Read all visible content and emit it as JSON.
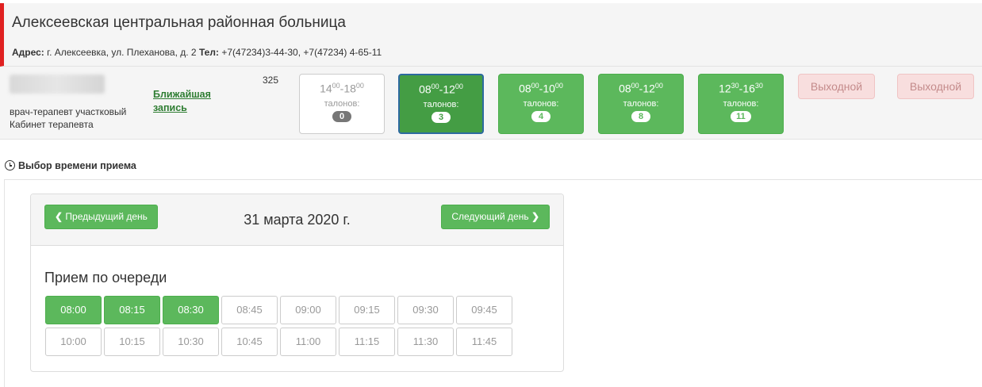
{
  "hospital": {
    "name": "Алексеевская центральная районная больница",
    "address_label": "Адрес:",
    "address": "г. Алексеевка, ул. Плеханова, д. 2",
    "phone_label": "Тел:",
    "phone": "+7(47234)3-44-30, +7(47234) 4-65-11"
  },
  "doctor": {
    "specialty": "врач-терапевт участковый",
    "cabinet": "Кабинет терапевта",
    "nearest_line1": "Ближайшая",
    "nearest_line2": "запись",
    "room": "325"
  },
  "schedule": [
    {
      "start_h": "14",
      "start_m": "00",
      "end_h": "18",
      "end_m": "00",
      "label": "талонов:",
      "count": "0",
      "state": "inactive"
    },
    {
      "start_h": "08",
      "start_m": "00",
      "end_h": "12",
      "end_m": "00",
      "label": "талонов:",
      "count": "3",
      "state": "active"
    },
    {
      "start_h": "08",
      "start_m": "00",
      "end_h": "10",
      "end_m": "00",
      "label": "талонов:",
      "count": "4",
      "state": "available"
    },
    {
      "start_h": "08",
      "start_m": "00",
      "end_h": "12",
      "end_m": "00",
      "label": "талонов:",
      "count": "8",
      "state": "available"
    },
    {
      "start_h": "12",
      "start_m": "30",
      "end_h": "16",
      "end_m": "30",
      "label": "талонов:",
      "count": "11",
      "state": "available"
    }
  ],
  "dayoff": [
    "Выходной",
    "Выходной"
  ],
  "section": {
    "title": "Выбор времени приема"
  },
  "day_nav": {
    "prev_label": "Предыдущий день",
    "date": "31 марта 2020 г.",
    "next_label": "Следующий день"
  },
  "queue": {
    "title": "Прием по очереди",
    "times": [
      {
        "t": "08:00",
        "available": true
      },
      {
        "t": "08:15",
        "available": true
      },
      {
        "t": "08:30",
        "available": true
      },
      {
        "t": "08:45",
        "available": false
      },
      {
        "t": "09:00",
        "available": false
      },
      {
        "t": "09:15",
        "available": false
      },
      {
        "t": "09:30",
        "available": false
      },
      {
        "t": "09:45",
        "available": false
      },
      {
        "t": "10:00",
        "available": false
      },
      {
        "t": "10:15",
        "available": false
      },
      {
        "t": "10:30",
        "available": false
      },
      {
        "t": "10:45",
        "available": false
      },
      {
        "t": "11:00",
        "available": false
      },
      {
        "t": "11:15",
        "available": false
      },
      {
        "t": "11:30",
        "available": false
      },
      {
        "t": "11:45",
        "available": false
      }
    ]
  },
  "colors": {
    "green": "#5cb85c",
    "dark_green": "#449d44",
    "red_accent": "#e02020",
    "dayoff_bg": "#f8dede"
  }
}
